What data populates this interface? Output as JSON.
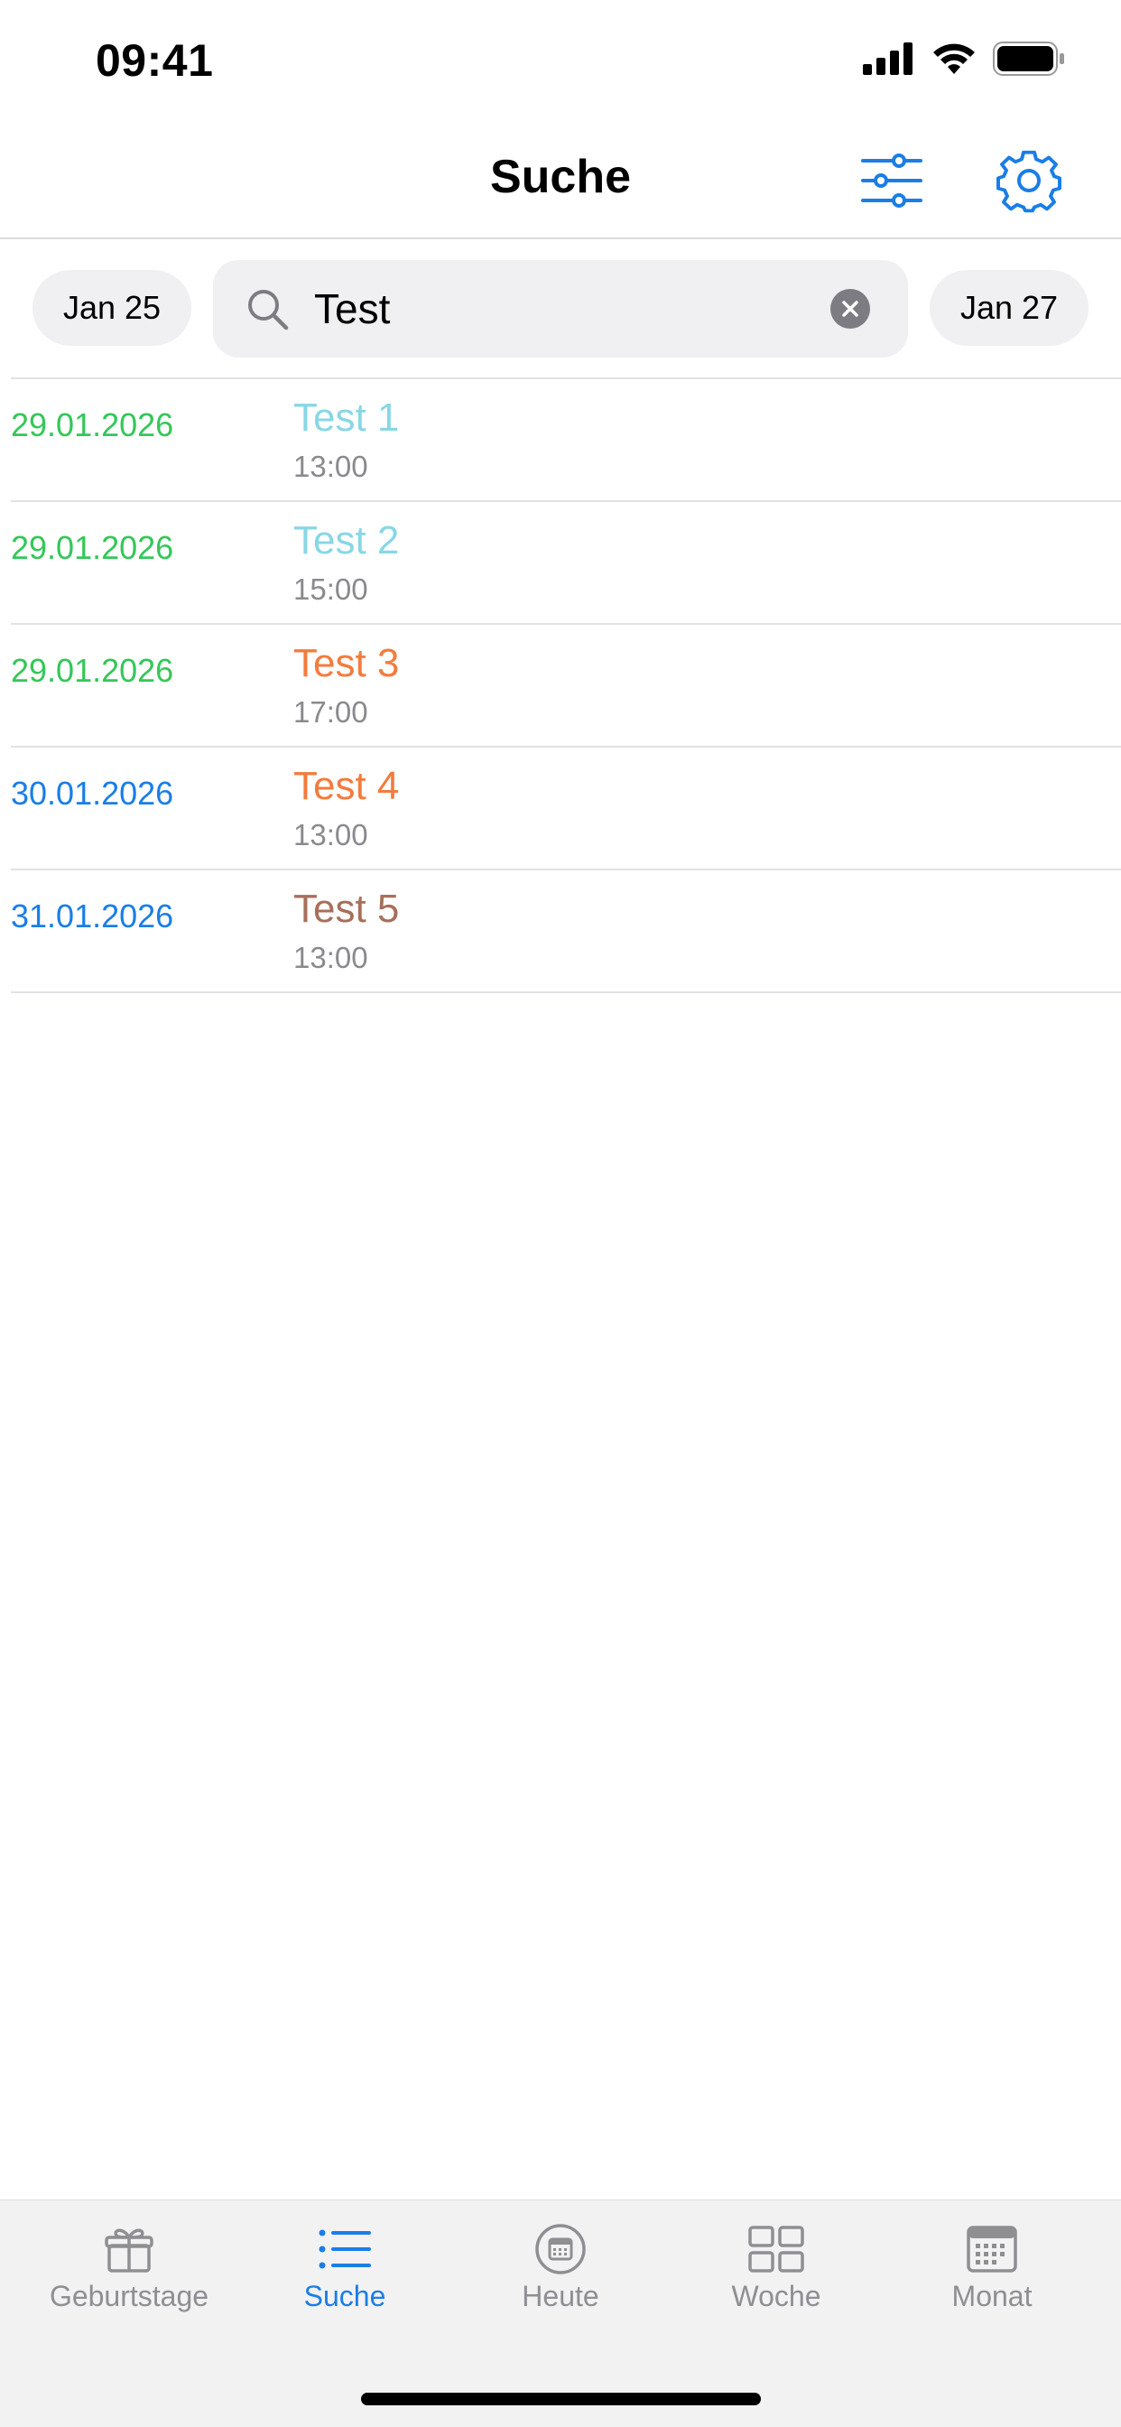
{
  "status_bar": {
    "time": "09:41",
    "icons": [
      "signal-icon",
      "wifi-icon",
      "battery-icon"
    ]
  },
  "nav": {
    "title": "Suche",
    "buttons": [
      "filter-sliders-icon",
      "gear-icon"
    ],
    "accent_color": "#1a7ee6"
  },
  "search": {
    "prev_date": "Jan 25",
    "query": "Test",
    "next_date": "Jan 27"
  },
  "results": [
    {
      "date": "29.01.2026",
      "date_color": "#34c759",
      "title": "Test 1",
      "title_color": "#88d7e6",
      "time": "13:00"
    },
    {
      "date": "29.01.2026",
      "date_color": "#34c759",
      "title": "Test 2",
      "title_color": "#88d7e6",
      "time": "15:00"
    },
    {
      "date": "29.01.2026",
      "date_color": "#34c759",
      "title": "Test 3",
      "title_color": "#f47b3d",
      "time": "17:00"
    },
    {
      "date": "30.01.2026",
      "date_color": "#1a7ee6",
      "title": "Test 4",
      "title_color": "#f47b3d",
      "time": "13:00"
    },
    {
      "date": "31.01.2026",
      "date_color": "#1a7ee6",
      "title": "Test 5",
      "title_color": "#a86f5b",
      "time": "13:00"
    }
  ],
  "tabs": [
    {
      "label": "Geburtstage",
      "icon": "gift-icon",
      "active": false
    },
    {
      "label": "Suche",
      "icon": "list-icon",
      "active": true
    },
    {
      "label": "Heute",
      "icon": "today-calendar-icon",
      "active": false
    },
    {
      "label": "Woche",
      "icon": "week-grid-icon",
      "active": false
    },
    {
      "label": "Monat",
      "icon": "month-calendar-icon",
      "active": false
    }
  ]
}
